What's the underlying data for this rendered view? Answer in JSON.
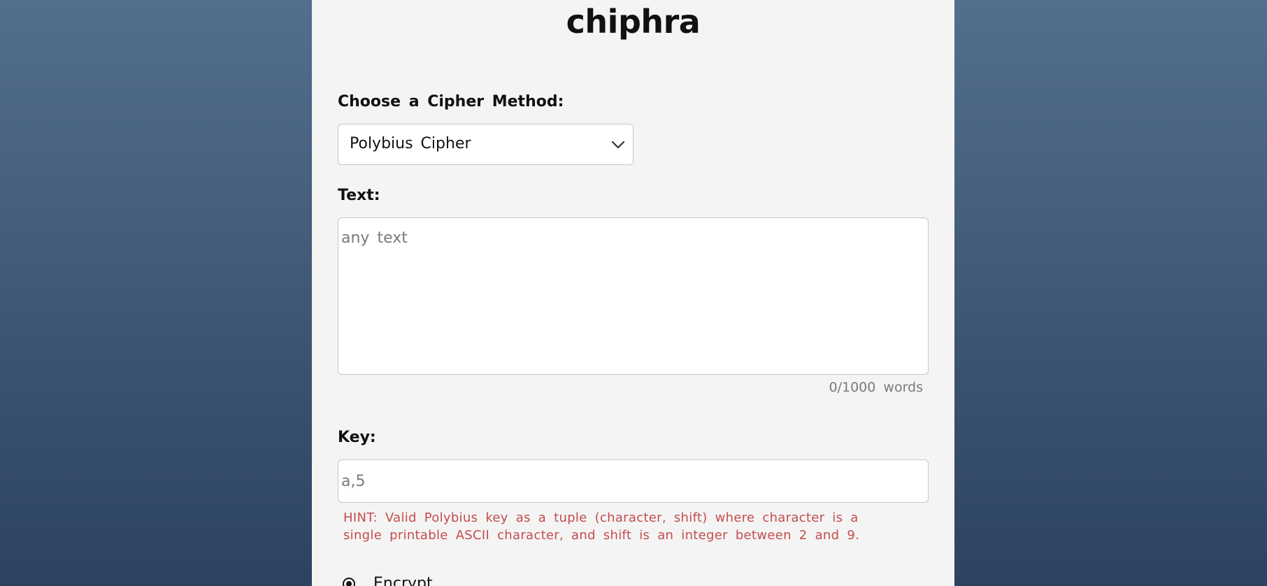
{
  "app": {
    "title": "chiphra"
  },
  "cipher": {
    "label": "Choose a Cipher Method:",
    "selected": "Polybius Cipher"
  },
  "text": {
    "label": "Text:",
    "placeholder": "any text",
    "value": "",
    "word_count": "0/1000 words"
  },
  "key": {
    "label": "Key:",
    "placeholder": "a,5",
    "value": "",
    "hint": "HINT: Valid Polybius key as a tuple (character, shift) where character is a single printable ASCII character, and shift is an integer between 2 and 9."
  },
  "mode": {
    "selected_label": "Encrypt"
  },
  "icons": {
    "select_arrow": "chevron-down-icon",
    "radio": "radio-selected-icon"
  },
  "colors": {
    "background_top": "#536f8d",
    "background_bottom": "#2c4260",
    "panel": "#f4f4f4",
    "hint": "#c44d4d"
  }
}
